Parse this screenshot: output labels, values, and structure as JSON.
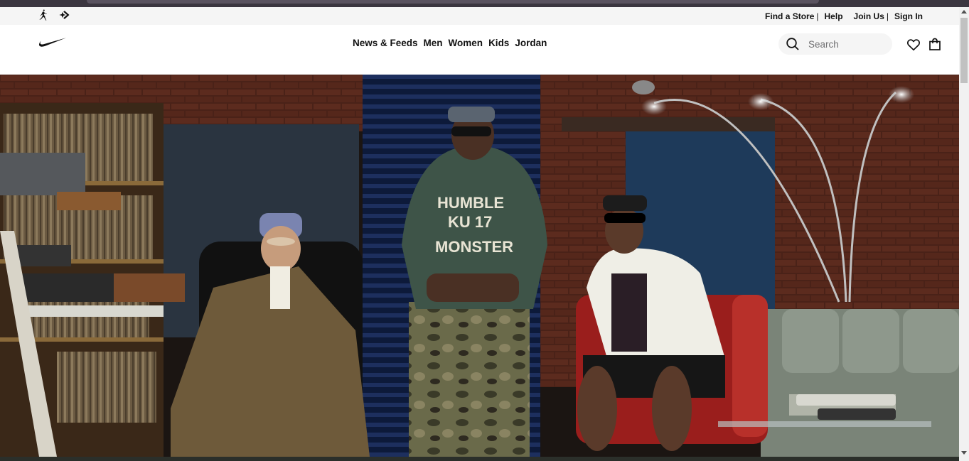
{
  "utility": {
    "brands": [
      {
        "icon": "jordan-jumpman-icon"
      },
      {
        "icon": "converse-star-chevron-icon"
      }
    ],
    "links": [
      {
        "label": "Find a Store"
      },
      {
        "label": "Help"
      },
      {
        "label": "Join Us"
      },
      {
        "label": "Sign In"
      }
    ],
    "separator": "|"
  },
  "nav": {
    "logo_icon": "nike-swoosh-icon",
    "menu": [
      {
        "label": "News & Feeds"
      },
      {
        "label": "Men"
      },
      {
        "label": "Women"
      },
      {
        "label": "Kids"
      },
      {
        "label": "Jordan"
      }
    ],
    "search": {
      "placeholder": "Search",
      "value": ""
    },
    "favorites_icon": "heart-icon",
    "bag_icon": "shopping-bag-icon"
  },
  "hero": {
    "image_icon": "hero-photo-three-men-in-studio",
    "hoodie_text": [
      "HUMBLE",
      "KU 17",
      "MONSTER"
    ]
  },
  "colors": {
    "utility_bg": "#f5f5f5",
    "text": "#111111",
    "search_bg": "#f5f5f5",
    "placeholder": "#707072"
  }
}
